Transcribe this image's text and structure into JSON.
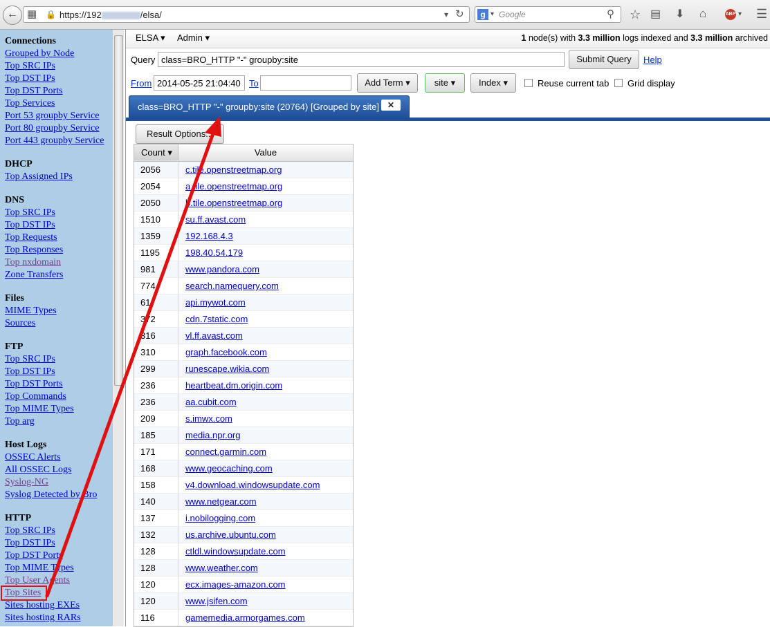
{
  "browser": {
    "url": "https://192.168.4.100/elsa/",
    "url_prefix": "https://192",
    "url_suffix": "/elsa/",
    "search_placeholder": "Google",
    "search_engine_letter": "g",
    "abp_label": "ABP"
  },
  "sidebar": {
    "sections": [
      {
        "title": "Connections",
        "links": [
          "Grouped by Node",
          "Top SRC IPs",
          "Top DST IPs",
          "Top DST Ports",
          "Top Services",
          "Port 53 groupby Service",
          "Port 80 groupby Service",
          "Port 443 groupby Service"
        ]
      },
      {
        "title": "DHCP",
        "links": [
          "Top Assigned IPs"
        ]
      },
      {
        "title": "DNS",
        "links": [
          "Top SRC IPs",
          "Top DST IPs",
          "Top Requests",
          "Top Responses",
          "Top nxdomain",
          "Zone Transfers"
        ]
      },
      {
        "title": "Files",
        "links": [
          "MIME Types",
          "Sources"
        ]
      },
      {
        "title": "FTP",
        "links": [
          "Top SRC IPs",
          "Top DST IPs",
          "Top DST Ports",
          "Top Commands",
          "Top MIME Types",
          "Top arg"
        ]
      },
      {
        "title": "Host Logs",
        "links": [
          "OSSEC Alerts",
          "All OSSEC Logs",
          "Syslog-NG",
          "Syslog Detected by Bro"
        ]
      },
      {
        "title": "HTTP",
        "links": [
          "Top SRC IPs",
          "Top DST IPs",
          "Top DST Ports",
          "Top MIME Types",
          "Top User Agents",
          "Top Sites",
          "Sites hosting EXEs",
          "Sites hosting RARs"
        ]
      }
    ]
  },
  "topbar": {
    "elsa_menu": "ELSA",
    "admin_menu": "Admin",
    "status_nodes": "1",
    "status_mid1": " node(s) with ",
    "status_logs": "3.3 million",
    "status_mid2": " logs indexed and ",
    "status_archived": "3.3 million",
    "status_end": " archived"
  },
  "query": {
    "label": "Query",
    "value": "class=BRO_HTTP \"-\" groupby:site",
    "submit": "Submit Query",
    "help": "Help",
    "from_label": "From",
    "from_value": "2014-05-25 21:04:40",
    "to_label": "To",
    "to_value": "",
    "add_term": "Add Term",
    "groupby_value": "site",
    "index_label": "Index",
    "reuse_tab": "Reuse current tab",
    "grid_display": "Grid display"
  },
  "tab": {
    "label": "class=BRO_HTTP \"-\" groupby:site (20764) [Grouped by site]",
    "close": "✕"
  },
  "results": {
    "options_button": "Result Options...",
    "col_count": "Count",
    "col_value": "Value",
    "rows": [
      {
        "count": "2056",
        "value": "c.tile.openstreetmap.org"
      },
      {
        "count": "2054",
        "value": "a.tile.openstreetmap.org"
      },
      {
        "count": "2050",
        "value": "b.tile.openstreetmap.org"
      },
      {
        "count": "1510",
        "value": "su.ff.avast.com"
      },
      {
        "count": "1359",
        "value": "192.168.4.3"
      },
      {
        "count": "1195",
        "value": "198.40.54.179"
      },
      {
        "count": "981",
        "value": "www.pandora.com"
      },
      {
        "count": "774",
        "value": "search.namequery.com"
      },
      {
        "count": "61",
        "value": "api.mywot.com"
      },
      {
        "count": "372",
        "value": "cdn.7static.com"
      },
      {
        "count": "316",
        "value": "vl.ff.avast.com"
      },
      {
        "count": "310",
        "value": "graph.facebook.com"
      },
      {
        "count": "299",
        "value": "runescape.wikia.com"
      },
      {
        "count": "236",
        "value": "heartbeat.dm.origin.com"
      },
      {
        "count": "236",
        "value": "aa.cubit.com"
      },
      {
        "count": "209",
        "value": "s.imwx.com"
      },
      {
        "count": "185",
        "value": "media.npr.org"
      },
      {
        "count": "171",
        "value": "connect.garmin.com"
      },
      {
        "count": "168",
        "value": "www.geocaching.com"
      },
      {
        "count": "158",
        "value": "v4.download.windowsupdate.com"
      },
      {
        "count": "140",
        "value": "www.netgear.com"
      },
      {
        "count": "137",
        "value": "i.nobilogging.com"
      },
      {
        "count": "132",
        "value": "us.archive.ubuntu.com"
      },
      {
        "count": "128",
        "value": "ctldl.windowsupdate.com"
      },
      {
        "count": "128",
        "value": "www.weather.com"
      },
      {
        "count": "120",
        "value": "ecx.images-amazon.com"
      },
      {
        "count": "120",
        "value": "www.jsifen.com"
      },
      {
        "count": "116",
        "value": "gamemedia.armorgames.com"
      }
    ]
  },
  "annotation_color": "#e01010"
}
